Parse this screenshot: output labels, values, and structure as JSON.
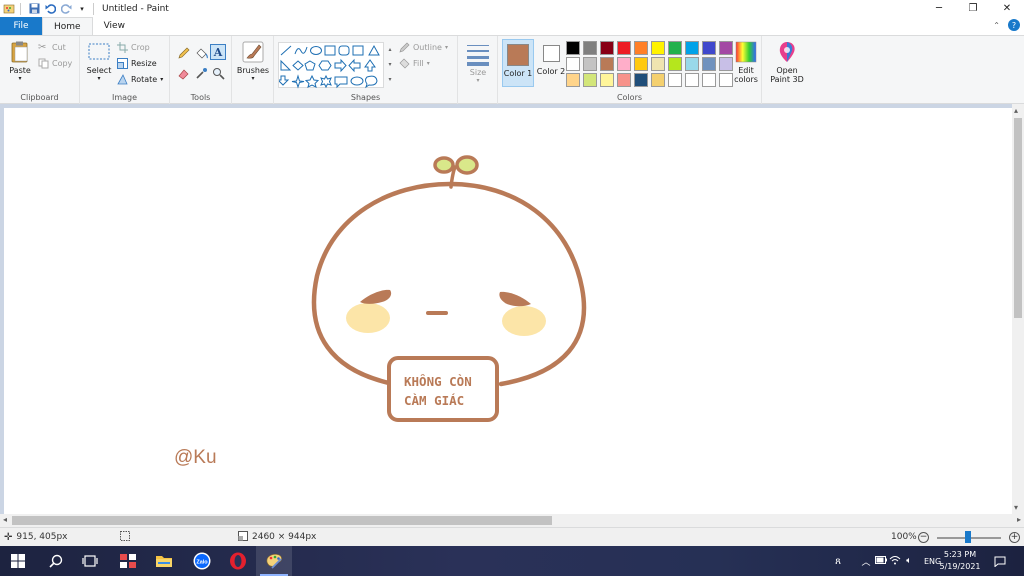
{
  "app": {
    "title": "Untitled - Paint",
    "window_controls": [
      "minimize",
      "restore",
      "close"
    ]
  },
  "tabs": {
    "file": "File",
    "home": "Home",
    "view": "View"
  },
  "ribbon": {
    "clipboard": {
      "label": "Clipboard",
      "paste": "Paste",
      "cut": "Cut",
      "copy": "Copy"
    },
    "image": {
      "label": "Image",
      "select": "Select",
      "crop": "Crop",
      "resize": "Resize",
      "rotate": "Rotate"
    },
    "tools": {
      "label": "Tools"
    },
    "brushes": {
      "label": "Brushes"
    },
    "shapes": {
      "label": "Shapes",
      "outline": "Outline",
      "fill": "Fill"
    },
    "size": {
      "label": "Size"
    },
    "colors": {
      "label": "Colors",
      "color1": "Color 1",
      "color1_value": "#b97a57",
      "color2": "Color 2",
      "color2_value": "#ffffff",
      "edit_colors": "Edit colors",
      "palette": [
        "#000000",
        "#7f7f7f",
        "#880015",
        "#ed1c24",
        "#ff7f27",
        "#fff200",
        "#22b14c",
        "#00a2e8",
        "#3f48cc",
        "#a349a4",
        "#ffffff",
        "#c3c3c3",
        "#b97a57",
        "#ffaec9",
        "#ffc90e",
        "#efe4b0",
        "#b5e61d",
        "#99d9ea",
        "#7092be",
        "#c8bfe7",
        "#ffd48a",
        "#d3e67a",
        "#fff59a",
        "#f7928a",
        "#1f4e79",
        "#f4d06f",
        "#ffffff",
        "#ffffff",
        "#ffffff",
        "#ffffff"
      ]
    },
    "paint3d": "Open Paint 3D"
  },
  "canvas": {
    "sign_line1": "KHÔNG CÒN",
    "sign_line2": "CÀM GIÁC",
    "signature": "@Ku",
    "stroke_color": "#b97a57",
    "blush_color": "#fce5a8",
    "sprout_fill": "#d9e88a"
  },
  "status": {
    "cursor_pos": "915, 405px",
    "image_size": "2460 × 944px",
    "zoom": "100%"
  },
  "taskbar": {
    "language": "ENG",
    "time": "5:23 PM",
    "date": "5/19/2021"
  }
}
